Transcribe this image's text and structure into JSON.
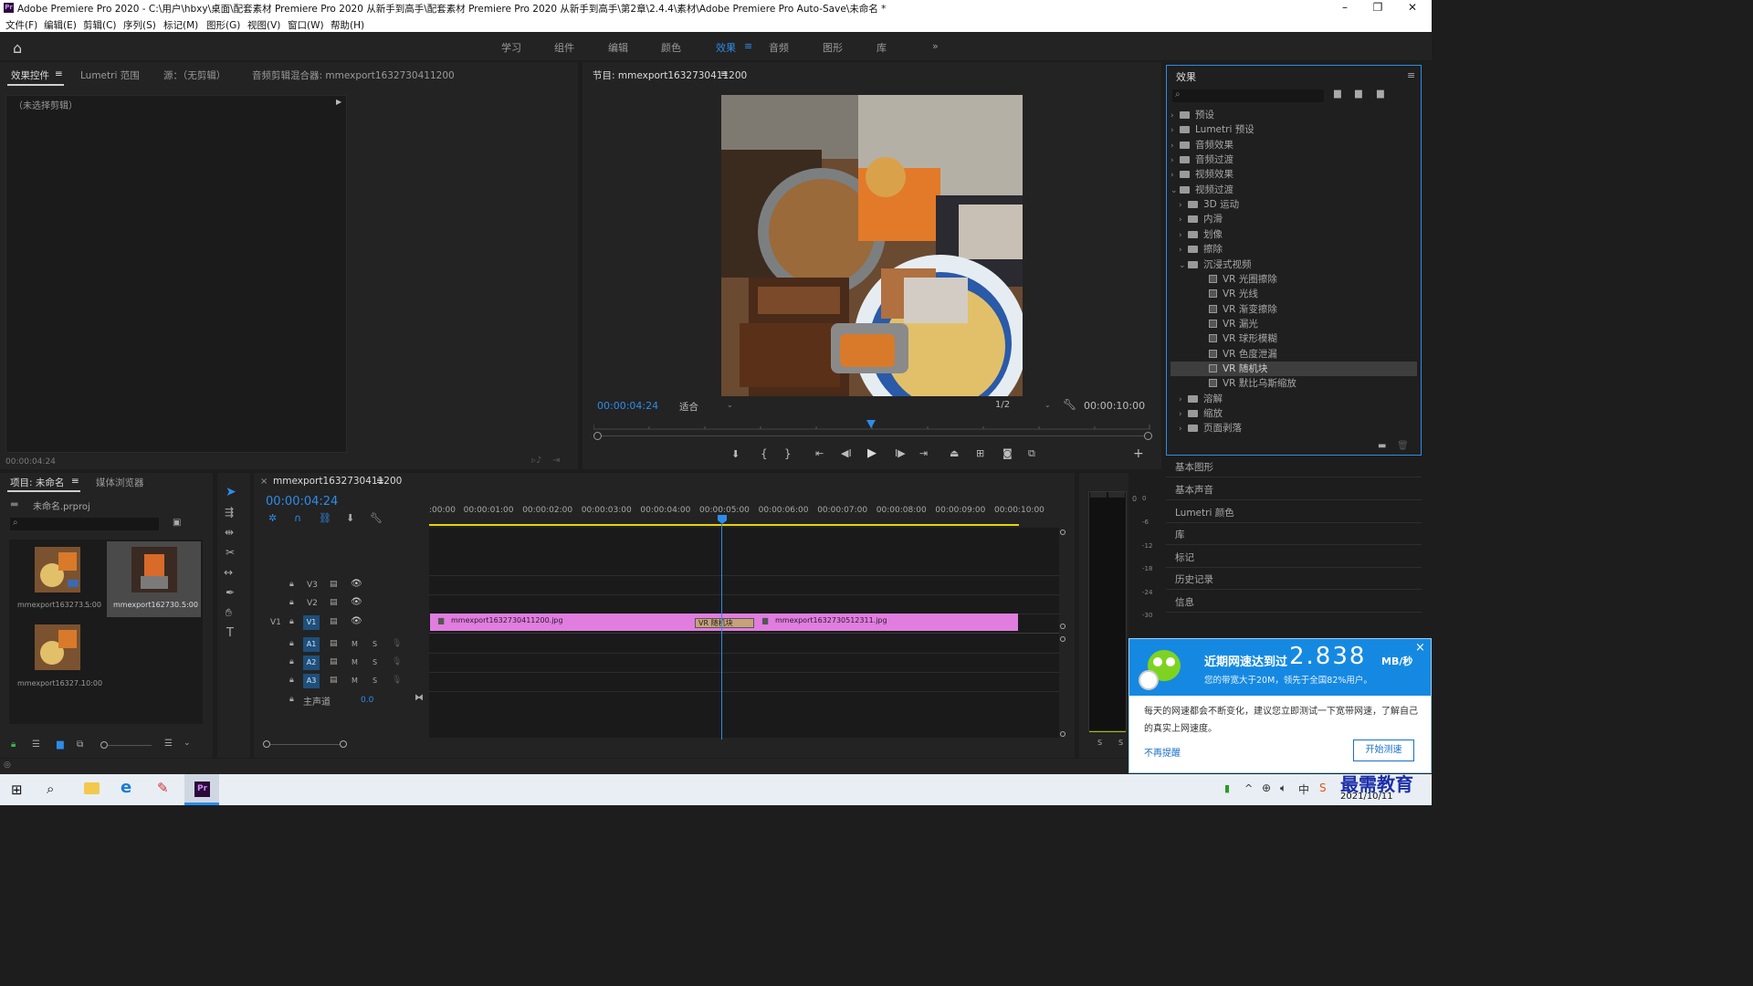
{
  "window": {
    "title": "Adobe Premiere Pro 2020 - C:\\用户\\hbxy\\桌面\\配套素材 Premiere Pro 2020 从新手到高手\\配套素材 Premiere Pro 2020 从新手到高手\\第2章\\2.4.4\\素材\\Adobe Premiere Pro Auto-Save\\未命名 *",
    "app_icon": "Pr"
  },
  "menu": [
    "文件(F)",
    "编辑(E)",
    "剪辑(C)",
    "序列(S)",
    "标记(M)",
    "图形(G)",
    "视图(V)",
    "窗口(W)",
    "帮助(H)"
  ],
  "workspaces": [
    {
      "label": "学习"
    },
    {
      "label": "组件"
    },
    {
      "label": "编辑"
    },
    {
      "label": "颜色"
    },
    {
      "label": "效果",
      "active": true
    },
    {
      "label": "音频"
    },
    {
      "label": "图形"
    },
    {
      "label": "库"
    }
  ],
  "source_panel": {
    "tabs": [
      "效果控件",
      "Lumetri 范围",
      "源：（无剪辑）",
      "音频剪辑混合器: mmexport1632730411200"
    ],
    "no_clip": "（未选择剪辑）",
    "timecode": "00:00:04:24"
  },
  "program": {
    "title": "节目: mmexport1632730411200",
    "timecode": "00:00:04:24",
    "fit": "适合",
    "resolution": "1/2",
    "duration": "00:00:10:00",
    "playhead_fraction": 0.497
  },
  "project": {
    "tabs": [
      "项目: 未命名",
      "媒体浏览器"
    ],
    "file": "未命名.prproj",
    "items": [
      {
        "name": "mmexport163273...",
        "duration": "5:00"
      },
      {
        "name": "mmexport162730...",
        "duration": "5:00",
        "selected": true
      },
      {
        "name": "mmexport16327...",
        "duration": "10:00"
      }
    ]
  },
  "timeline": {
    "tab": "mmexport1632730411200",
    "timecode": "00:00:04:24",
    "ruler": [
      ":00:00",
      "00:00:01:00",
      "00:00:02:00",
      "00:00:03:00",
      "00:00:04:00",
      "00:00:05:00",
      "00:00:06:00",
      "00:00:07:00",
      "00:00:08:00",
      "00:00:09:00",
      "00:00:10:00"
    ],
    "tracks": {
      "video": [
        "V3",
        "V2",
        "V1"
      ],
      "audio": [
        "A1",
        "A2",
        "A3"
      ],
      "source_patch": "V1",
      "master": "主声道",
      "master_value": "0.0",
      "mute": "M",
      "solo": "S"
    },
    "clips": [
      {
        "name": "mmexport1632730411200.jpg"
      },
      {
        "name": "mmexport1632730512311.jpg"
      }
    ],
    "transition": "VR 随机块"
  },
  "meter_labels": [
    "0",
    "-6",
    "-12",
    "-18",
    "-24",
    "-30"
  ],
  "meter_footer": [
    "S",
    "S"
  ],
  "effects_panel": {
    "title": "效果",
    "tree": [
      {
        "label": "预设",
        "level": 0,
        "kind": "folder",
        "exp": "›"
      },
      {
        "label": "Lumetri 预设",
        "level": 0,
        "kind": "folder",
        "exp": "›"
      },
      {
        "label": "音频效果",
        "level": 0,
        "kind": "folder",
        "exp": "›"
      },
      {
        "label": "音频过渡",
        "level": 0,
        "kind": "folder",
        "exp": "›"
      },
      {
        "label": "视频效果",
        "level": 0,
        "kind": "folder",
        "exp": "›"
      },
      {
        "label": "视频过渡",
        "level": 0,
        "kind": "folder",
        "exp": "⌄"
      },
      {
        "label": "3D 运动",
        "level": 1,
        "kind": "folder",
        "exp": "›"
      },
      {
        "label": "内滑",
        "level": 1,
        "kind": "folder",
        "exp": "›"
      },
      {
        "label": "划像",
        "level": 1,
        "kind": "folder",
        "exp": "›"
      },
      {
        "label": "擦除",
        "level": 1,
        "kind": "folder",
        "exp": "›"
      },
      {
        "label": "沉浸式视频",
        "level": 1,
        "kind": "folder",
        "exp": "⌄"
      },
      {
        "label": "VR 光圈擦除",
        "level": 2,
        "kind": "vr"
      },
      {
        "label": "VR 光线",
        "level": 2,
        "kind": "vr"
      },
      {
        "label": "VR 渐变擦除",
        "level": 2,
        "kind": "vr"
      },
      {
        "label": "VR 漏光",
        "level": 2,
        "kind": "vr"
      },
      {
        "label": "VR 球形模糊",
        "level": 2,
        "kind": "vr"
      },
      {
        "label": "VR 色度泄漏",
        "level": 2,
        "kind": "vr"
      },
      {
        "label": "VR 随机块",
        "level": 2,
        "kind": "vr",
        "selected": true
      },
      {
        "label": "VR 默比乌斯缩放",
        "level": 2,
        "kind": "vr"
      },
      {
        "label": "溶解",
        "level": 1,
        "kind": "folder",
        "exp": "›"
      },
      {
        "label": "缩放",
        "level": 1,
        "kind": "folder",
        "exp": "›"
      },
      {
        "label": "页面剥落",
        "level": 1,
        "kind": "folder",
        "exp": "›"
      }
    ]
  },
  "side_panels": [
    "基本图形",
    "基本声音",
    "Lumetri 颜色",
    "库",
    "标记",
    "历史记录",
    "信息"
  ],
  "notification": {
    "headline": "近期网速达到过",
    "speed": "2.838",
    "unit": "MB/秒",
    "subline": "您的带宽大于20M，领先于全国82%用户。",
    "body": "每天的网速都会不断变化，建议您立即测试一下宽带网速，了解自己的真实上网速度。",
    "dismiss": "不再提醒",
    "start": "开始测速",
    "close": "×"
  },
  "taskbar": {
    "watermark": "最需教育",
    "date": "2021/10/11"
  },
  "colors": {
    "accent": "#2d8ceb",
    "clip": "#e07ddf",
    "panel_bg": "#232323",
    "notif_blue": "#1589e1"
  }
}
